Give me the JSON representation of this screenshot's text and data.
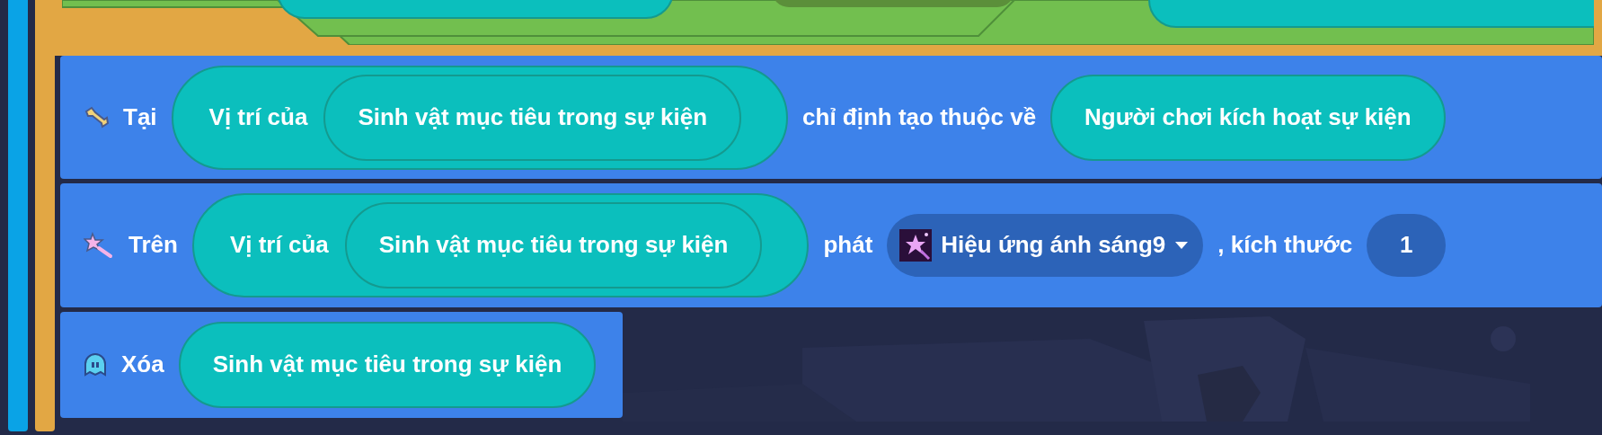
{
  "blocks": [
    {
      "kind": "flag",
      "parts": [
        {
          "kind": "label",
          "text": "Tại"
        },
        {
          "kind": "slot",
          "text": "Vị trí của",
          "child": {
            "kind": "slot",
            "text": "Sinh vật mục tiêu trong sự kiện"
          }
        },
        {
          "kind": "label",
          "text": "chỉ định tạo thuộc về"
        },
        {
          "kind": "slot",
          "text": "Người chơi kích hoạt sự kiện"
        }
      ]
    },
    {
      "kind": "effect",
      "parts": [
        {
          "kind": "label",
          "text": "Trên"
        },
        {
          "kind": "slot",
          "text": "Vị trí của",
          "child": {
            "kind": "slot",
            "text": "Sinh vật mục tiêu trong sự kiện"
          }
        },
        {
          "kind": "label",
          "text": "phát"
        },
        {
          "kind": "dropdown",
          "text": "Hiệu ứng ánh sáng9"
        },
        {
          "kind": "label",
          "text": ", kích thước"
        },
        {
          "kind": "number",
          "text": "1"
        }
      ]
    },
    {
      "kind": "remove",
      "parts": [
        {
          "kind": "label",
          "text": "Xóa"
        },
        {
          "kind": "slot",
          "text": "Sinh vật mục tiêu trong sự kiện"
        }
      ]
    }
  ]
}
